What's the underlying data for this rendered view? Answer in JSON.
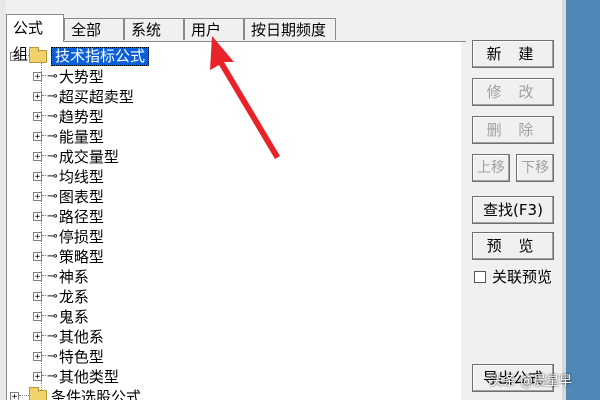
{
  "tabs": [
    {
      "label": "公式组",
      "active": true
    },
    {
      "label": "全部",
      "active": false
    },
    {
      "label": "系统",
      "active": false
    },
    {
      "label": "用户",
      "active": false
    },
    {
      "label": "按日期频度",
      "active": false
    }
  ],
  "tree": {
    "root": {
      "label": "技术指标公式",
      "expander": "⊟"
    },
    "children": [
      {
        "label": "大势型"
      },
      {
        "label": "超买超卖型"
      },
      {
        "label": "趋势型"
      },
      {
        "label": "能量型"
      },
      {
        "label": "成交量型"
      },
      {
        "label": "均线型"
      },
      {
        "label": "图表型"
      },
      {
        "label": "路径型"
      },
      {
        "label": "停损型"
      },
      {
        "label": "策略型"
      },
      {
        "label": "神系"
      },
      {
        "label": "龙系"
      },
      {
        "label": "鬼系"
      },
      {
        "label": "其他系"
      },
      {
        "label": "特色型"
      },
      {
        "label": "其他类型"
      }
    ],
    "next_root": {
      "label": "条件选股公式"
    }
  },
  "buttons": {
    "new": "新 建",
    "edit": "修 改",
    "delete": "删 除",
    "move_up": "上移",
    "move_down": "下移",
    "find": "查找(F3)",
    "preview": "预 览",
    "export": "导出公式"
  },
  "checkbox": {
    "label": "关联预览",
    "checked": false
  },
  "watermark": "头条 @晨星早",
  "colors": {
    "selection": "#0a5fd6",
    "arrow": "#e8232a",
    "folder": "#f2d36b"
  }
}
